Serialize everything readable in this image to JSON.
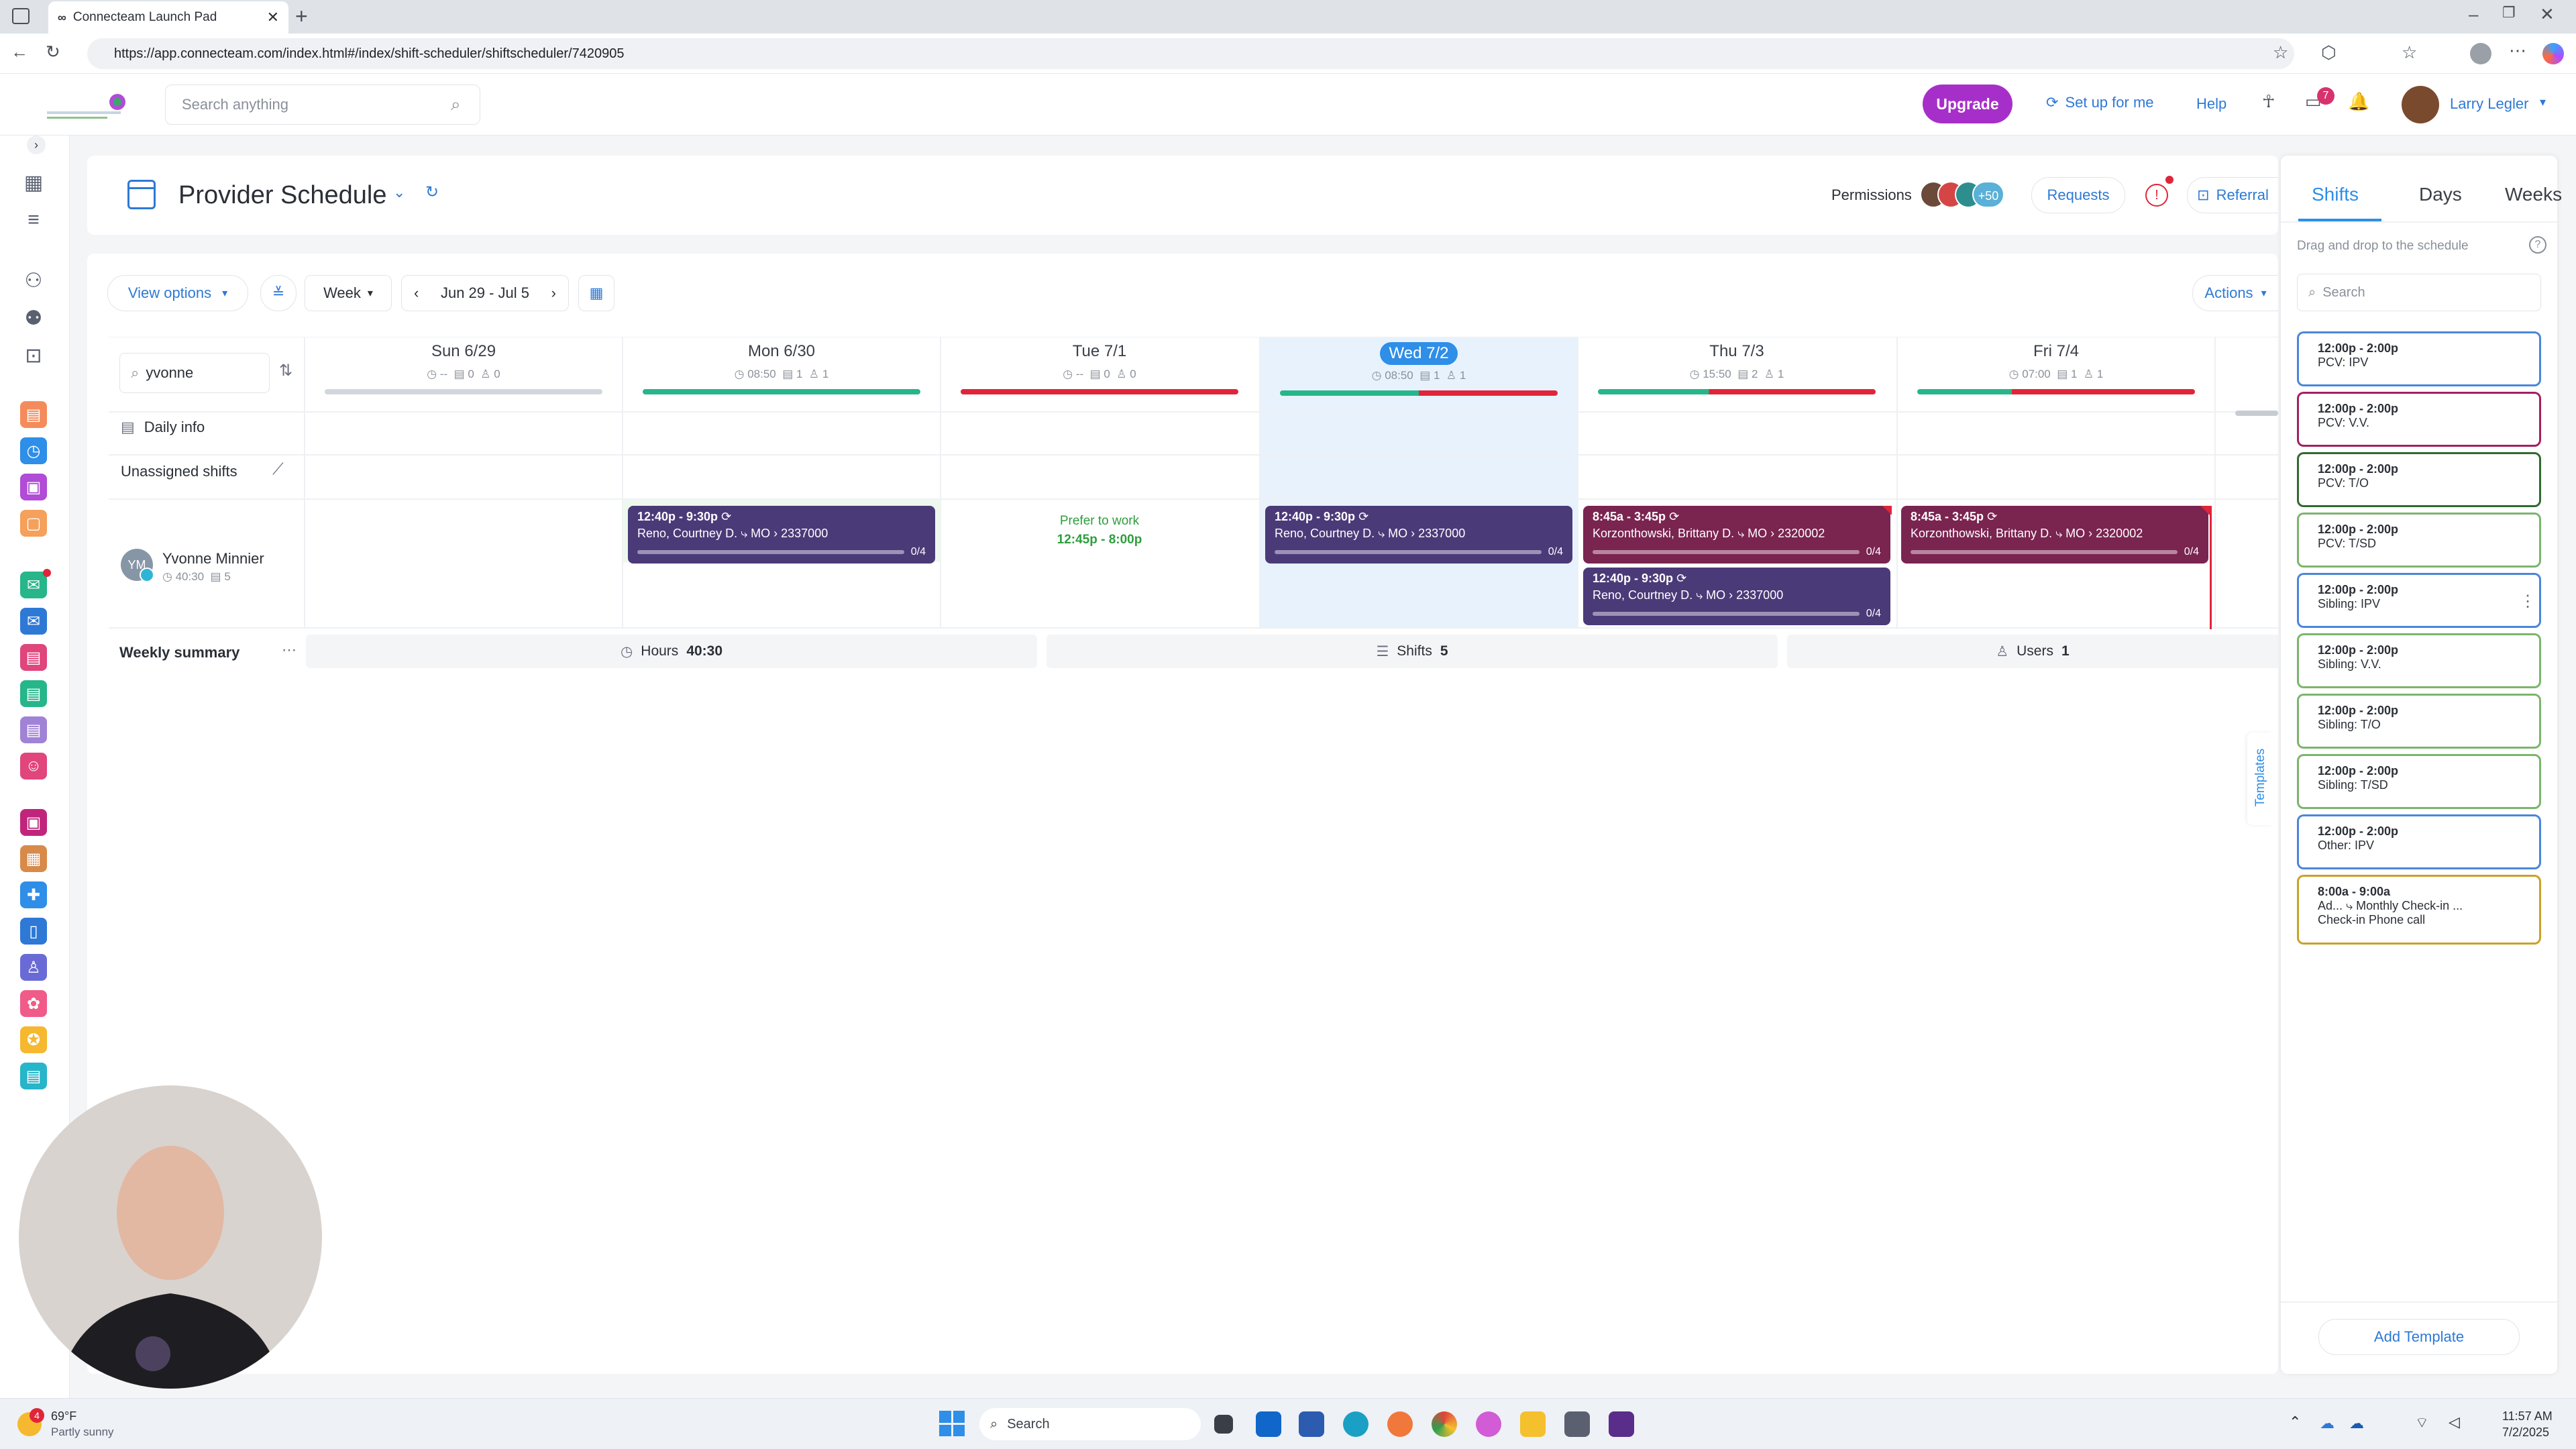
{
  "browser": {
    "tab_title": "Connecteam Launch Pad",
    "url": "https://app.connecteam.com/index.html#/index/shift-scheduler/shiftscheduler/7420905"
  },
  "header": {
    "search_placeholder": "Search anything",
    "upgrade": "Upgrade",
    "setup": "Set up for me",
    "help": "Help",
    "chat_badge": "7",
    "user_name": "Larry Legler"
  },
  "title": {
    "page_title": "Provider Schedule",
    "permissions": "Permissions",
    "perm_more": "+50",
    "requests": "Requests",
    "referral": "Referral"
  },
  "toolbar": {
    "view_options": "View options",
    "week": "Week",
    "date_range": "Jun 29 - Jul 5",
    "actions": "Actions",
    "filter_value": "yvonne"
  },
  "days": [
    {
      "name": "Sun 6/29",
      "hours": "--",
      "shifts": "0",
      "users": "0"
    },
    {
      "name": "Mon 6/30",
      "hours": "08:50",
      "shifts": "1",
      "users": "1"
    },
    {
      "name": "Tue 7/1",
      "hours": "--",
      "shifts": "0",
      "users": "0"
    },
    {
      "name": "Wed 7/2",
      "hours": "08:50",
      "shifts": "1",
      "users": "1"
    },
    {
      "name": "Thu 7/3",
      "hours": "15:50",
      "shifts": "2",
      "users": "1"
    },
    {
      "name": "Fri 7/4",
      "hours": "07:00",
      "shifts": "1",
      "users": "1"
    }
  ],
  "rows": {
    "daily_info": "Daily info",
    "unassigned": "Unassigned shifts",
    "weekly_summary": "Weekly summary"
  },
  "user": {
    "initials": "YM",
    "name": "Yvonne Minnier",
    "hours": "40:30",
    "shifts": "5"
  },
  "shifts": {
    "mon": {
      "time": "12:40p - 9:30p",
      "detail": "Reno, Courtney D. ⤷ MO › 2337000",
      "count": "0/4"
    },
    "tue": {
      "label": "Prefer to work",
      "time": "12:45p - 8:00p"
    },
    "wed": {
      "time": "12:40p - 9:30p",
      "detail": "Reno, Courtney D. ⤷ MO › 2337000",
      "count": "0/4"
    },
    "thu1": {
      "time": "8:45a - 3:45p",
      "detail": "Korzonthowski, Brittany D. ⤷ MO › 2320002",
      "count": "0/4"
    },
    "thu2": {
      "time": "12:40p - 9:30p",
      "detail": "Reno, Courtney D. ⤷ MO › 2337000",
      "count": "0/4"
    },
    "fri": {
      "time": "8:45a - 3:45p",
      "detail": "Korzonthowski, Brittany D. ⤷ MO › 2320002",
      "count": "0/4"
    }
  },
  "summary": {
    "hours_label": "Hours",
    "hours": "40:30",
    "shifts_label": "Shifts",
    "shifts": "5",
    "users_label": "Users",
    "users": "1"
  },
  "panel": {
    "tabs": [
      "Shifts",
      "Days",
      "Weeks"
    ],
    "hint": "Drag and drop to the schedule",
    "search_placeholder": "Search",
    "templates_tab": "Templates",
    "add_template": "Add Template",
    "cards": [
      {
        "time": "12:00p - 2:00p",
        "label": "PCV: IPV",
        "color": "#4a86d9"
      },
      {
        "time": "12:00p - 2:00p",
        "label": "PCV: V.V.",
        "color": "#a3205f"
      },
      {
        "time": "12:00p - 2:00p",
        "label": "PCV: T/O",
        "color": "#2f6b2f"
      },
      {
        "time": "12:00p - 2:00p",
        "label": "PCV: T/SD",
        "color": "#7bb56c"
      },
      {
        "time": "12:00p - 2:00p",
        "label": "Sibling: IPV",
        "color": "#4a86d9"
      },
      {
        "time": "12:00p - 2:00p",
        "label": "Sibling: V.V.",
        "color": "#7bb56c"
      },
      {
        "time": "12:00p - 2:00p",
        "label": "Sibling: T/O",
        "color": "#7bb56c"
      },
      {
        "time": "12:00p - 2:00p",
        "label": "Sibling: T/SD",
        "color": "#7bb56c"
      },
      {
        "time": "12:00p - 2:00p",
        "label": "Other: IPV",
        "color": "#4a86d9"
      },
      {
        "time": "8:00a - 9:00a",
        "label": "Ad...     ⤷ Monthly Check-in ...",
        "label2": "Check-in Phone call",
        "color": "#c9a227"
      }
    ]
  },
  "taskbar": {
    "weather_temp": "69°F",
    "weather_desc": "Partly sunny",
    "weather_badge": "4",
    "search": "Search",
    "time": "11:57 AM",
    "date": "7/2/2025"
  }
}
